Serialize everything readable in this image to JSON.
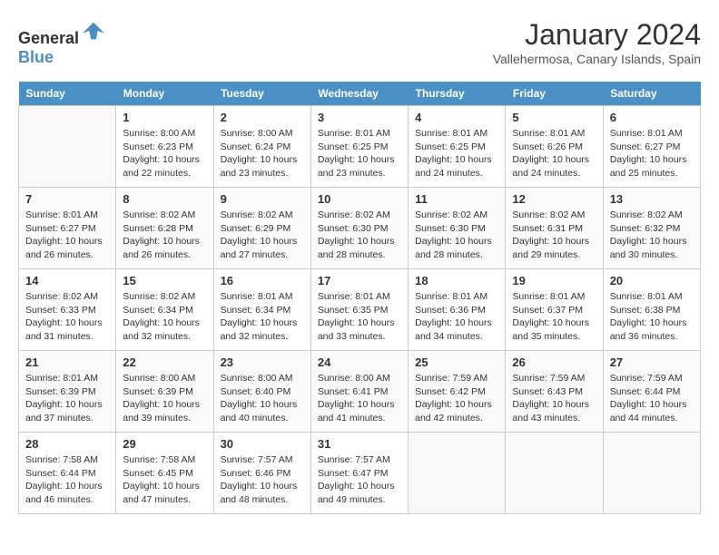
{
  "header": {
    "logo_general": "General",
    "logo_blue": "Blue",
    "month_year": "January 2024",
    "location": "Vallehermosa, Canary Islands, Spain"
  },
  "days_of_week": [
    "Sunday",
    "Monday",
    "Tuesday",
    "Wednesday",
    "Thursday",
    "Friday",
    "Saturday"
  ],
  "weeks": [
    [
      {
        "day": "",
        "info": ""
      },
      {
        "day": "1",
        "info": "Sunrise: 8:00 AM\nSunset: 6:23 PM\nDaylight: 10 hours\nand 22 minutes."
      },
      {
        "day": "2",
        "info": "Sunrise: 8:00 AM\nSunset: 6:24 PM\nDaylight: 10 hours\nand 23 minutes."
      },
      {
        "day": "3",
        "info": "Sunrise: 8:01 AM\nSunset: 6:25 PM\nDaylight: 10 hours\nand 23 minutes."
      },
      {
        "day": "4",
        "info": "Sunrise: 8:01 AM\nSunset: 6:25 PM\nDaylight: 10 hours\nand 24 minutes."
      },
      {
        "day": "5",
        "info": "Sunrise: 8:01 AM\nSunset: 6:26 PM\nDaylight: 10 hours\nand 24 minutes."
      },
      {
        "day": "6",
        "info": "Sunrise: 8:01 AM\nSunset: 6:27 PM\nDaylight: 10 hours\nand 25 minutes."
      }
    ],
    [
      {
        "day": "7",
        "info": "Sunrise: 8:01 AM\nSunset: 6:27 PM\nDaylight: 10 hours\nand 26 minutes."
      },
      {
        "day": "8",
        "info": "Sunrise: 8:02 AM\nSunset: 6:28 PM\nDaylight: 10 hours\nand 26 minutes."
      },
      {
        "day": "9",
        "info": "Sunrise: 8:02 AM\nSunset: 6:29 PM\nDaylight: 10 hours\nand 27 minutes."
      },
      {
        "day": "10",
        "info": "Sunrise: 8:02 AM\nSunset: 6:30 PM\nDaylight: 10 hours\nand 28 minutes."
      },
      {
        "day": "11",
        "info": "Sunrise: 8:02 AM\nSunset: 6:30 PM\nDaylight: 10 hours\nand 28 minutes."
      },
      {
        "day": "12",
        "info": "Sunrise: 8:02 AM\nSunset: 6:31 PM\nDaylight: 10 hours\nand 29 minutes."
      },
      {
        "day": "13",
        "info": "Sunrise: 8:02 AM\nSunset: 6:32 PM\nDaylight: 10 hours\nand 30 minutes."
      }
    ],
    [
      {
        "day": "14",
        "info": "Sunrise: 8:02 AM\nSunset: 6:33 PM\nDaylight: 10 hours\nand 31 minutes."
      },
      {
        "day": "15",
        "info": "Sunrise: 8:02 AM\nSunset: 6:34 PM\nDaylight: 10 hours\nand 32 minutes."
      },
      {
        "day": "16",
        "info": "Sunrise: 8:01 AM\nSunset: 6:34 PM\nDaylight: 10 hours\nand 32 minutes."
      },
      {
        "day": "17",
        "info": "Sunrise: 8:01 AM\nSunset: 6:35 PM\nDaylight: 10 hours\nand 33 minutes."
      },
      {
        "day": "18",
        "info": "Sunrise: 8:01 AM\nSunset: 6:36 PM\nDaylight: 10 hours\nand 34 minutes."
      },
      {
        "day": "19",
        "info": "Sunrise: 8:01 AM\nSunset: 6:37 PM\nDaylight: 10 hours\nand 35 minutes."
      },
      {
        "day": "20",
        "info": "Sunrise: 8:01 AM\nSunset: 6:38 PM\nDaylight: 10 hours\nand 36 minutes."
      }
    ],
    [
      {
        "day": "21",
        "info": "Sunrise: 8:01 AM\nSunset: 6:39 PM\nDaylight: 10 hours\nand 37 minutes."
      },
      {
        "day": "22",
        "info": "Sunrise: 8:00 AM\nSunset: 6:39 PM\nDaylight: 10 hours\nand 39 minutes."
      },
      {
        "day": "23",
        "info": "Sunrise: 8:00 AM\nSunset: 6:40 PM\nDaylight: 10 hours\nand 40 minutes."
      },
      {
        "day": "24",
        "info": "Sunrise: 8:00 AM\nSunset: 6:41 PM\nDaylight: 10 hours\nand 41 minutes."
      },
      {
        "day": "25",
        "info": "Sunrise: 7:59 AM\nSunset: 6:42 PM\nDaylight: 10 hours\nand 42 minutes."
      },
      {
        "day": "26",
        "info": "Sunrise: 7:59 AM\nSunset: 6:43 PM\nDaylight: 10 hours\nand 43 minutes."
      },
      {
        "day": "27",
        "info": "Sunrise: 7:59 AM\nSunset: 6:44 PM\nDaylight: 10 hours\nand 44 minutes."
      }
    ],
    [
      {
        "day": "28",
        "info": "Sunrise: 7:58 AM\nSunset: 6:44 PM\nDaylight: 10 hours\nand 46 minutes."
      },
      {
        "day": "29",
        "info": "Sunrise: 7:58 AM\nSunset: 6:45 PM\nDaylight: 10 hours\nand 47 minutes."
      },
      {
        "day": "30",
        "info": "Sunrise: 7:57 AM\nSunset: 6:46 PM\nDaylight: 10 hours\nand 48 minutes."
      },
      {
        "day": "31",
        "info": "Sunrise: 7:57 AM\nSunset: 6:47 PM\nDaylight: 10 hours\nand 49 minutes."
      },
      {
        "day": "",
        "info": ""
      },
      {
        "day": "",
        "info": ""
      },
      {
        "day": "",
        "info": ""
      }
    ]
  ]
}
